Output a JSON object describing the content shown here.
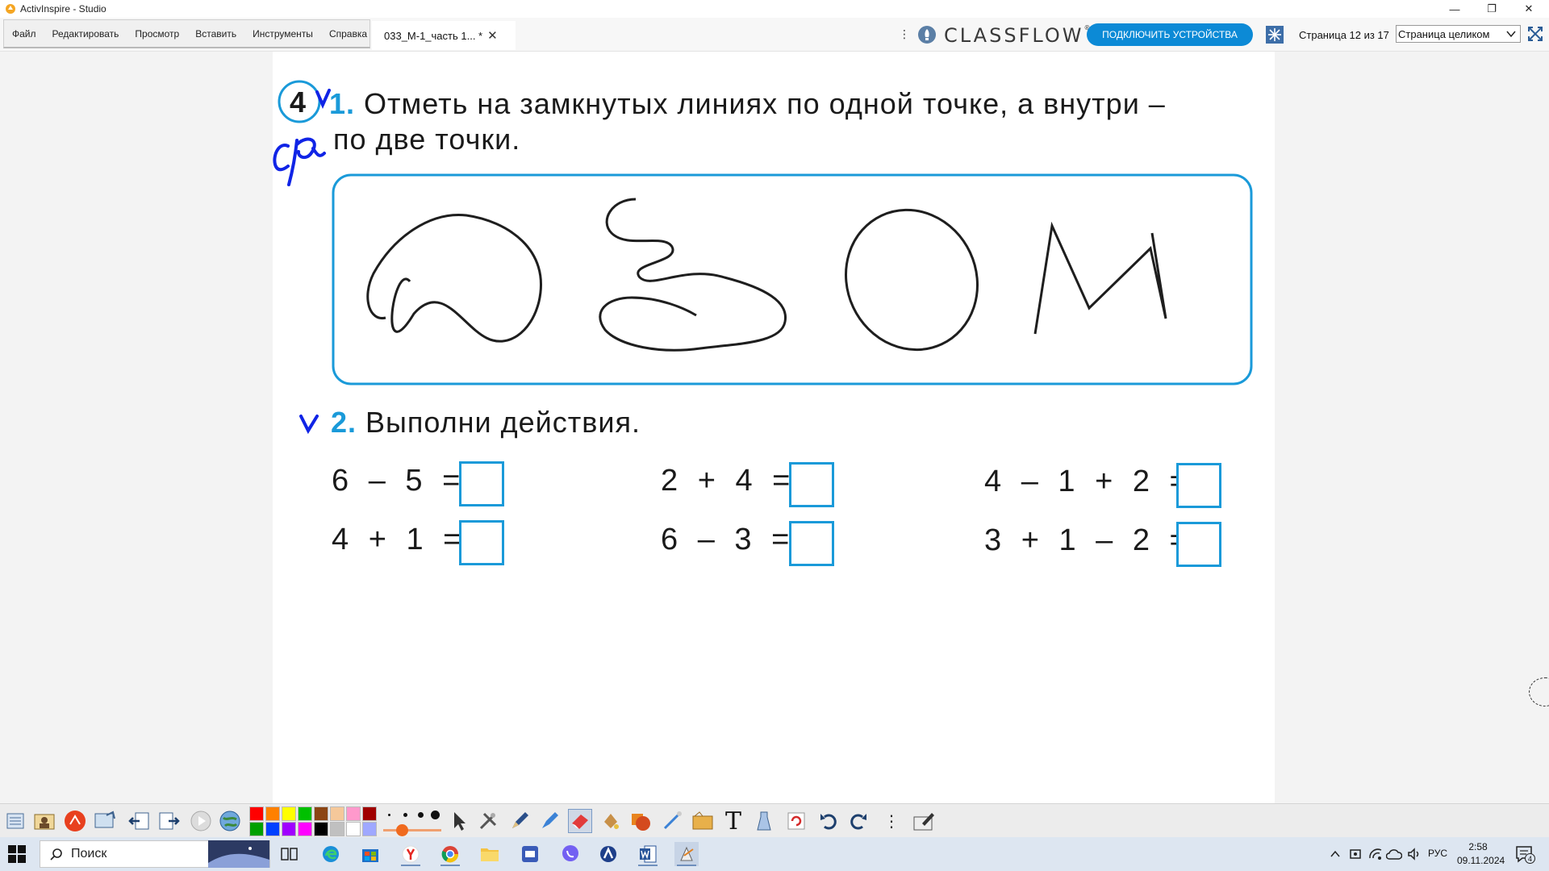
{
  "window": {
    "title": "ActivInspire - Studio",
    "minimize": "—",
    "restore": "❐",
    "close": "✕"
  },
  "menu": [
    "Файл",
    "Редактировать",
    "Просмотр",
    "Вставить",
    "Инструменты",
    "Справка"
  ],
  "doc_tab": {
    "label": "033_М-1_часть 1... *",
    "close": "✕"
  },
  "header": {
    "kebab": "⋮",
    "logo": "CLASSFLOW",
    "logo_mark": "®",
    "connect_button": "ПОДКЛЮЧИТЬ УСТРОЙСТВА",
    "page_counter": "Страница 12 из 17",
    "zoom_value": "Страница целиком"
  },
  "page": {
    "task1_num": "1.",
    "task1_line1": "Отметь на замкнутых линиях по одной точке, а внутри –",
    "task1_line2": "по две точки.",
    "task2_num": "2.",
    "task2_text": "Выполни действия.",
    "badge_number": "4",
    "handwriting": {
      "mark1": "v",
      "mark2": "v",
      "note": "ср"
    },
    "equations": [
      "6 – 5 =",
      "4 + 1 =",
      "2 + 4 =",
      "6 – 3 =",
      "4 – 1 + 2 =",
      "3 + 1 – 2 ="
    ],
    "colors": {
      "accent_blue": "#1a9ad9",
      "ink_blue": "#1024e6"
    }
  },
  "toolbar": {
    "palette": [
      "#ff0000",
      "#ff8000",
      "#ffff00",
      "#00c000",
      "#8b4513",
      "#f5c89a",
      "#ff99cc",
      "#a00000",
      "#00a000",
      "#0040ff",
      "#a000ff",
      "#ff00ff",
      "#000000",
      "#c0c0c0",
      "#ffffff",
      "#9fa8ff"
    ],
    "text_tool": "T",
    "more": "⋮"
  },
  "taskbar": {
    "search_placeholder": "Поиск",
    "lang": "РУС",
    "time": "2:58",
    "date": "09.11.2024",
    "notifications": "4"
  }
}
